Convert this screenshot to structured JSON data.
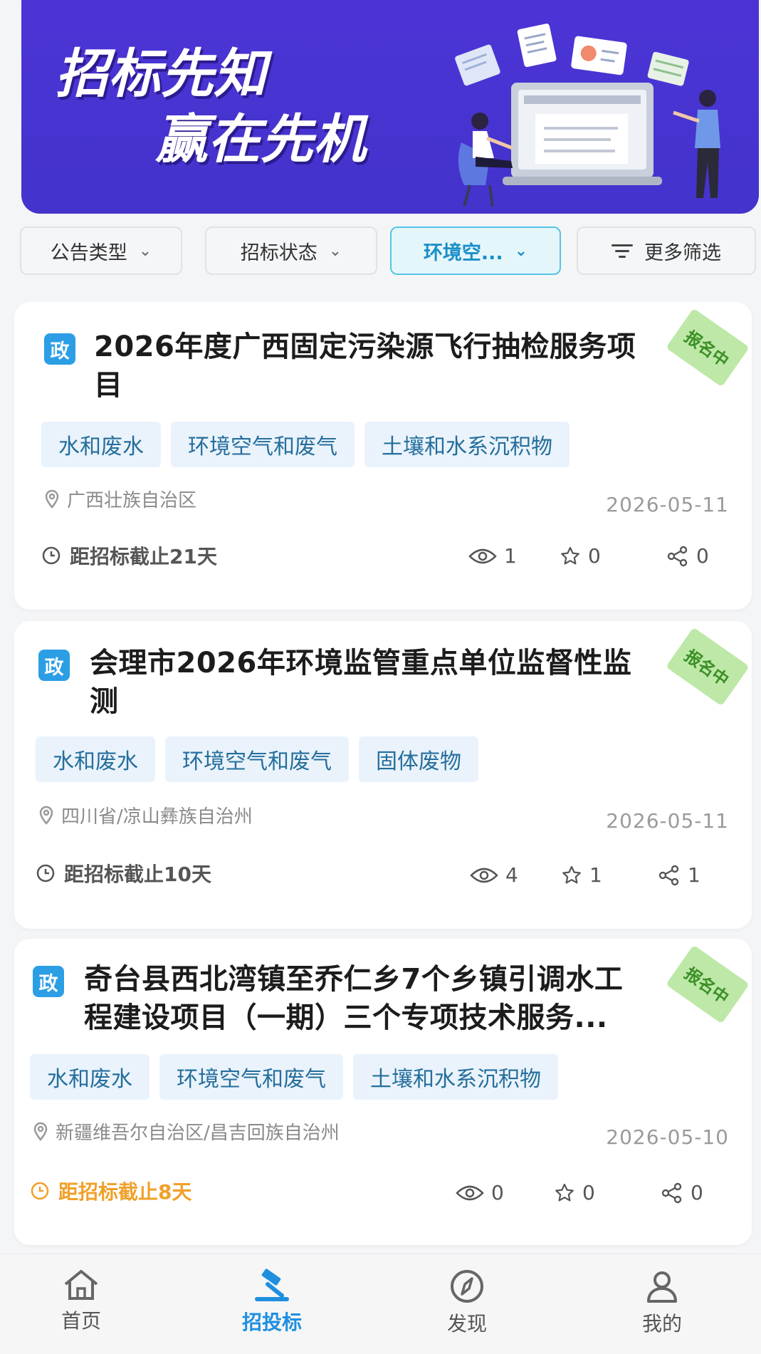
{
  "banner": {
    "title_line1": "招标先知",
    "title_line2": "赢在先机"
  },
  "filters": [
    {
      "label": "公告类型",
      "active": false
    },
    {
      "label": "招标状态",
      "active": false
    },
    {
      "label": "环境空...",
      "active": true
    },
    {
      "label": "更多筛选",
      "active": false
    }
  ],
  "cards": [
    {
      "badge": "政",
      "title_line1": "2026年度广西固定污染源飞行抽检服务项",
      "title_line2": "目",
      "status": "报名中",
      "tags": [
        "水和废水",
        "环境空气和废气",
        "土壤和水系沉积物"
      ],
      "location": "广西壮族自治区",
      "date": "2026-05-11",
      "deadline": "距招标截止21天",
      "deadline_warn": false,
      "views": "1",
      "stars": "0",
      "shares": "0"
    },
    {
      "badge": "政",
      "title_line1": "会理市2026年环境监管重点单位监督性监",
      "title_line2": "测",
      "status": "报名中",
      "tags": [
        "水和废水",
        "环境空气和废气",
        "固体废物"
      ],
      "location": "四川省/凉山彝族自治州",
      "date": "2026-05-11",
      "deadline": "距招标截止10天",
      "deadline_warn": false,
      "views": "4",
      "stars": "1",
      "shares": "1"
    },
    {
      "badge": "政",
      "title_line1": "奇台县西北湾镇至乔仁乡7个乡镇引调水工",
      "title_line2": "程建设项目（一期）三个专项技术服务...",
      "status": "报名中",
      "tags": [
        "水和废水",
        "环境空气和废气",
        "土壤和水系沉积物"
      ],
      "location": "新疆维吾尔自治区/昌吉回族自治州",
      "date": "2026-05-10",
      "deadline": "距招标截止8天",
      "deadline_warn": true,
      "views": "0",
      "stars": "0",
      "shares": "0"
    }
  ],
  "tabbar": [
    {
      "label": "首页",
      "icon": "home-icon",
      "active": false
    },
    {
      "label": "招投标",
      "icon": "gavel-icon",
      "active": true
    },
    {
      "label": "发现",
      "icon": "compass-icon",
      "active": false
    },
    {
      "label": "我的",
      "icon": "user-icon",
      "active": false
    }
  ],
  "colors": {
    "banner_bg": "#4433cc",
    "accent": "#1f8fe0",
    "badge": "#2b9ee5",
    "tag_bg": "#eaf3fb",
    "status_bg": "#bde8a7",
    "warn": "#f0a029"
  }
}
